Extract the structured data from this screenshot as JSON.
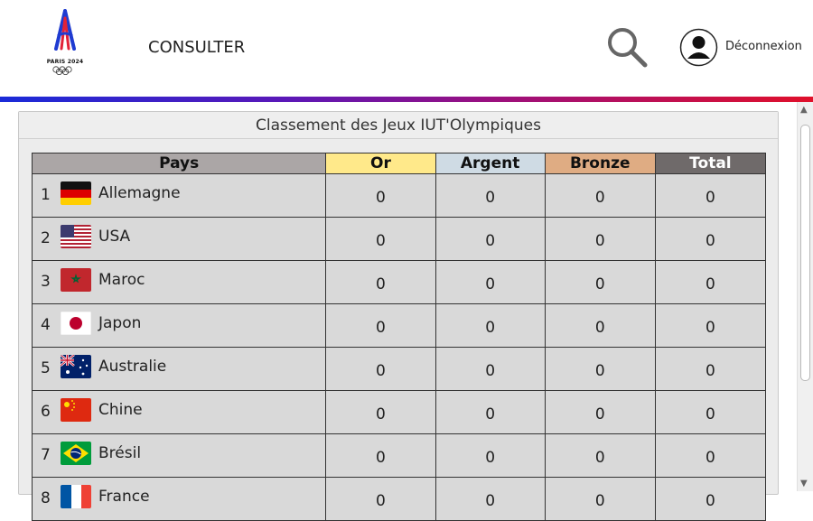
{
  "header": {
    "logo_text": "PARIS 2024",
    "nav_consulter": "CONSULTER",
    "logout_label": "Déconnexion"
  },
  "panel": {
    "title": "Classement des Jeux IUT'Olympiques"
  },
  "table": {
    "columns": [
      "Pays",
      "Or",
      "Argent",
      "Bronze",
      "Total"
    ],
    "rows": [
      {
        "rank": "1",
        "country": "Allemagne",
        "flag": "germany-flag-icon",
        "or": "0",
        "argent": "0",
        "bronze": "0",
        "total": "0"
      },
      {
        "rank": "2",
        "country": "USA",
        "flag": "usa-flag-icon",
        "or": "0",
        "argent": "0",
        "bronze": "0",
        "total": "0"
      },
      {
        "rank": "3",
        "country": "Maroc",
        "flag": "morocco-flag-icon",
        "or": "0",
        "argent": "0",
        "bronze": "0",
        "total": "0"
      },
      {
        "rank": "4",
        "country": "Japon",
        "flag": "japan-flag-icon",
        "or": "0",
        "argent": "0",
        "bronze": "0",
        "total": "0"
      },
      {
        "rank": "5",
        "country": "Australie",
        "flag": "australia-flag-icon",
        "or": "0",
        "argent": "0",
        "bronze": "0",
        "total": "0"
      },
      {
        "rank": "6",
        "country": "Chine",
        "flag": "china-flag-icon",
        "or": "0",
        "argent": "0",
        "bronze": "0",
        "total": "0"
      },
      {
        "rank": "7",
        "country": "Brésil",
        "flag": "brazil-flag-icon",
        "or": "0",
        "argent": "0",
        "bronze": "0",
        "total": "0"
      },
      {
        "rank": "8",
        "country": "France",
        "flag": "france-flag-icon",
        "or": "0",
        "argent": "0",
        "bronze": "0",
        "total": "0"
      }
    ]
  },
  "colors": {
    "header_pays": "#aba6a6",
    "header_or": "#ffe98a",
    "header_argent": "#cfdbe4",
    "header_bronze": "#dfac83",
    "header_total": "#6f6a6a",
    "row_bg": "#d9d9d9",
    "gradient_start": "#1a2bd8",
    "gradient_end": "#e0102a"
  },
  "icons": {
    "search": "search-icon",
    "avatar": "user-avatar-icon",
    "scroll_up": "▲",
    "scroll_down": "▼"
  }
}
